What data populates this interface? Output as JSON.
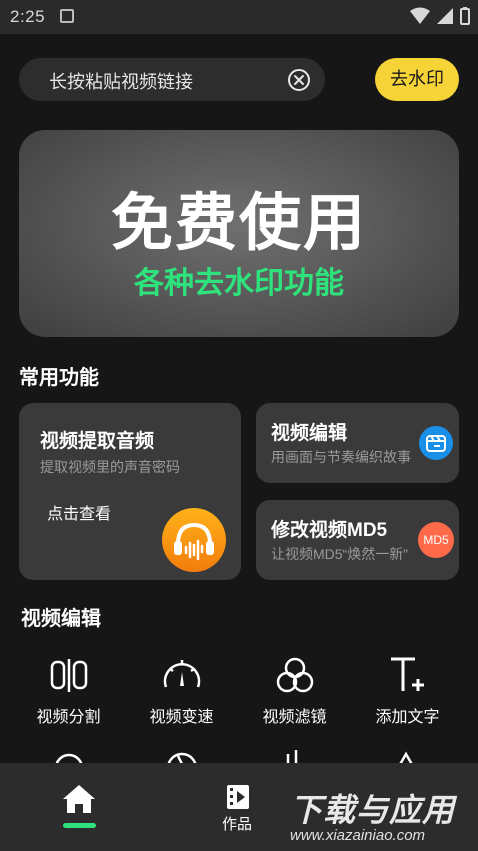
{
  "status_bar": {
    "time": "2:25"
  },
  "search": {
    "placeholder": "长按粘贴视频链接",
    "action_label": "去水印"
  },
  "banner": {
    "title": "免费使用",
    "subtitle": "各种去水印功能"
  },
  "common_section": {
    "title": "常用功能"
  },
  "cards": {
    "extract_audio": {
      "title": "视频提取音频",
      "desc": "提取视频里的声音密码",
      "link": "点击查看"
    },
    "video_edit": {
      "title": "视频编辑",
      "desc": "用画面与节奏编织故事"
    },
    "modify_md5": {
      "title": "修改视频MD5",
      "desc": "让视频MD5“焕然一新”",
      "badge": "MD5"
    }
  },
  "edit_section": {
    "title": "视频编辑",
    "tools": [
      {
        "label": "视频分割",
        "icon": "split-icon"
      },
      {
        "label": "视频变速",
        "icon": "speedometer-icon"
      },
      {
        "label": "视频滤镜",
        "icon": "filter-icon"
      },
      {
        "label": "添加文字",
        "icon": "add-text-icon"
      }
    ]
  },
  "bottom_nav": {
    "items": [
      {
        "label": "",
        "icon": "home-icon",
        "active": true
      },
      {
        "label": "作品",
        "icon": "works-icon",
        "active": false
      }
    ]
  },
  "watermark": {
    "text": "下载与应用",
    "url": "www.xiazainiao.com"
  },
  "colors": {
    "accent_green": "#2fe37c",
    "accent_yellow": "#f6d336",
    "background": "#161616",
    "card": "#3a3a3a"
  }
}
